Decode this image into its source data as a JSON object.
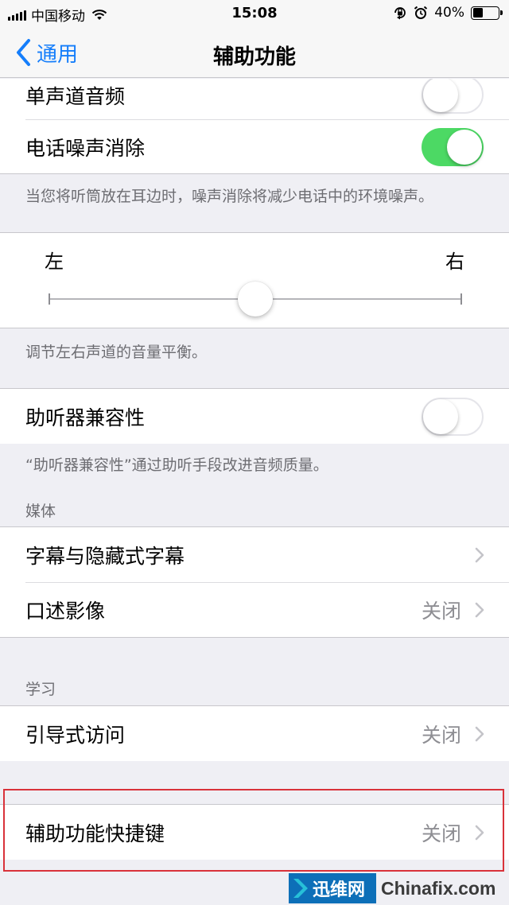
{
  "status_bar": {
    "carrier": "中国移动",
    "time": "15:08",
    "battery_percent": "40%",
    "battery_level": 0.4,
    "icons": [
      "signal-icon",
      "wifi-icon",
      "orientation-lock-icon",
      "alarm-icon",
      "battery-icon"
    ]
  },
  "nav": {
    "back_label": "通用",
    "title": "辅助功能"
  },
  "audio": {
    "mono_audio_label": "单声道音频",
    "mono_audio_on": false,
    "noise_cancel_label": "电话噪声消除",
    "noise_cancel_on": true,
    "noise_cancel_footer": "当您将听筒放在耳边时，噪声消除将减少电话中的环境噪声。"
  },
  "balance": {
    "left_label": "左",
    "right_label": "右",
    "value": 0.5,
    "footer": "调节左右声道的音量平衡。"
  },
  "hearing": {
    "hac_label": "助听器兼容性",
    "hac_on": false,
    "footer": "“助听器兼容性”通过助听手段改进音频质量。"
  },
  "media": {
    "header": "媒体",
    "captions_label": "字幕与隐藏式字幕",
    "audio_desc_label": "口述影像",
    "audio_desc_value": "关闭"
  },
  "learning": {
    "header": "学习",
    "guided_access_label": "引导式访问",
    "guided_access_value": "关闭"
  },
  "shortcut": {
    "label": "辅助功能快捷键",
    "value": "关闭"
  },
  "watermark": {
    "logo_text": "迅维网",
    "site": "Chinafix.com"
  },
  "colors": {
    "accent": "#157efb",
    "toggle_on": "#4cd964",
    "highlight": "#d9323a",
    "group_background": "#efeff4"
  }
}
